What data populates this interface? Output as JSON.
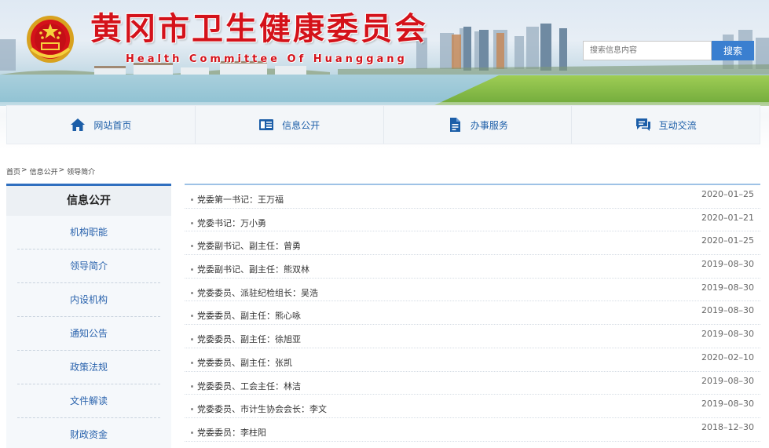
{
  "header": {
    "title": "黄冈市卫生健康委员会",
    "subtitle": "Health Committee Of Huanggang",
    "search_placeholder": "搜索信息内容",
    "search_button": "搜索"
  },
  "nav": [
    {
      "label": "网站首页",
      "icon": "home-icon"
    },
    {
      "label": "信息公开",
      "icon": "card-icon"
    },
    {
      "label": "办事服务",
      "icon": "document-icon"
    },
    {
      "label": "互动交流",
      "icon": "chat-icon"
    }
  ],
  "breadcrumb": {
    "home": "首页",
    "section": "信息公开",
    "current": "领导简介",
    "separator": ">"
  },
  "sidebar": {
    "header": "信息公开",
    "items": [
      {
        "label": "机构职能"
      },
      {
        "label": "领导简介"
      },
      {
        "label": "内设机构"
      },
      {
        "label": "通知公告"
      },
      {
        "label": "政策法规"
      },
      {
        "label": "文件解读"
      },
      {
        "label": "财政资金"
      }
    ]
  },
  "list": [
    {
      "title": "党委第一书记：王万福",
      "date": "2020–01–25"
    },
    {
      "title": "党委书记：万小勇",
      "date": "2020–01–21"
    },
    {
      "title": "党委副书记、副主任：曾勇",
      "date": "2020–01–25"
    },
    {
      "title": "党委副书记、副主任：熊双林",
      "date": "2019–08–30"
    },
    {
      "title": "党委委员、派驻纪检组长：吴浩",
      "date": "2019–08–30"
    },
    {
      "title": "党委委员、副主任：熊心咏",
      "date": "2019–08–30"
    },
    {
      "title": "党委委员、副主任：徐旭亚",
      "date": "2019–08–30"
    },
    {
      "title": "党委委员、副主任：张凯",
      "date": "2020–02–10"
    },
    {
      "title": "党委委员、工会主任：林洁",
      "date": "2019–08–30"
    },
    {
      "title": "党委委员、市计生协会会长：李文",
      "date": "2019–08–30"
    },
    {
      "title": "党委委员：李柱阳",
      "date": "2018–12–30"
    }
  ],
  "colors": {
    "brand_red": "#d4121a",
    "nav_blue": "#1c5ea8",
    "accent_blue": "#2f6fbf"
  }
}
